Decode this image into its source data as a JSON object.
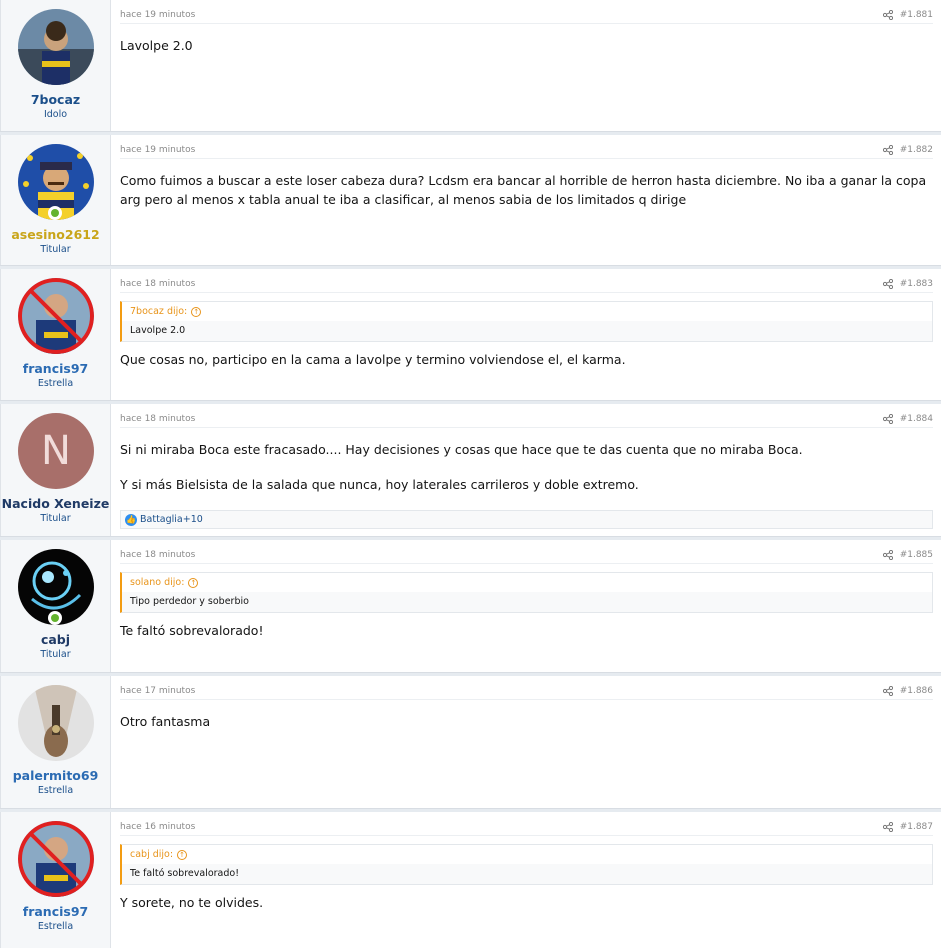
{
  "posts": [
    {
      "time": "hace 19 minutos",
      "number": "#1.881",
      "username": "7bocaz",
      "role": "Idolo",
      "online": false,
      "quote": null,
      "paragraphs": [
        "Lavolpe 2.0"
      ],
      "reactions": null
    },
    {
      "time": "hace 19 minutos",
      "number": "#1.882",
      "username": "asesino2612",
      "role": "Titular",
      "online": true,
      "quote": null,
      "paragraphs": [
        "Como fuimos a buscar a este loser cabeza dura? Lcdsm era bancar al horrible de herron hasta diciembre. No iba a ganar la copa arg pero al menos x tabla anual te iba a clasificar, al menos sabia de los limitados q dirige"
      ],
      "reactions": null
    },
    {
      "time": "hace 18 minutos",
      "number": "#1.883",
      "username": "francis97",
      "role": "Estrella",
      "online": false,
      "quote": {
        "author": "7bocaz dijo:",
        "text": "Lavolpe 2.0"
      },
      "paragraphs": [
        "Que cosas no, participo en la cama a lavolpe y termino volviendose el, el karma."
      ],
      "reactions": null
    },
    {
      "time": "hace 18 minutos",
      "number": "#1.884",
      "username": "Nacido Xeneize",
      "role": "Titular",
      "online": false,
      "quote": null,
      "paragraphs": [
        "Si ni miraba Boca este fracasado.... Hay decisiones y cosas que hace que te das cuenta que no miraba Boca.",
        "Y si más Bielsista de la salada que nunca, hoy laterales carrileros y doble extremo."
      ],
      "reactions": "Battaglia+10",
      "initial": "N"
    },
    {
      "time": "hace 18 minutos",
      "number": "#1.885",
      "username": "cabj",
      "role": "Titular",
      "online": true,
      "quote": {
        "author": "solano dijo:",
        "text": "Tipo perdedor y soberbio"
      },
      "paragraphs": [
        "Te faltó sobrevalorado!"
      ],
      "reactions": null
    },
    {
      "time": "hace 17 minutos",
      "number": "#1.886",
      "username": "palermito69",
      "role": "Estrella",
      "online": false,
      "quote": null,
      "paragraphs": [
        "Otro fantasma"
      ],
      "reactions": null
    },
    {
      "time": "hace 16 minutos",
      "number": "#1.887",
      "username": "francis97",
      "role": "Estrella",
      "online": false,
      "quote": {
        "author": "cabj dijo:",
        "text": "Te faltó sobrevalorado!"
      },
      "paragraphs": [
        "Y sorete, no te olvides."
      ],
      "reactions": null
    }
  ],
  "colors": {
    "username": "#1b4f8a",
    "quote_accent": "#f39c12",
    "online": "#63b32e",
    "like": "#2d8ef0"
  }
}
